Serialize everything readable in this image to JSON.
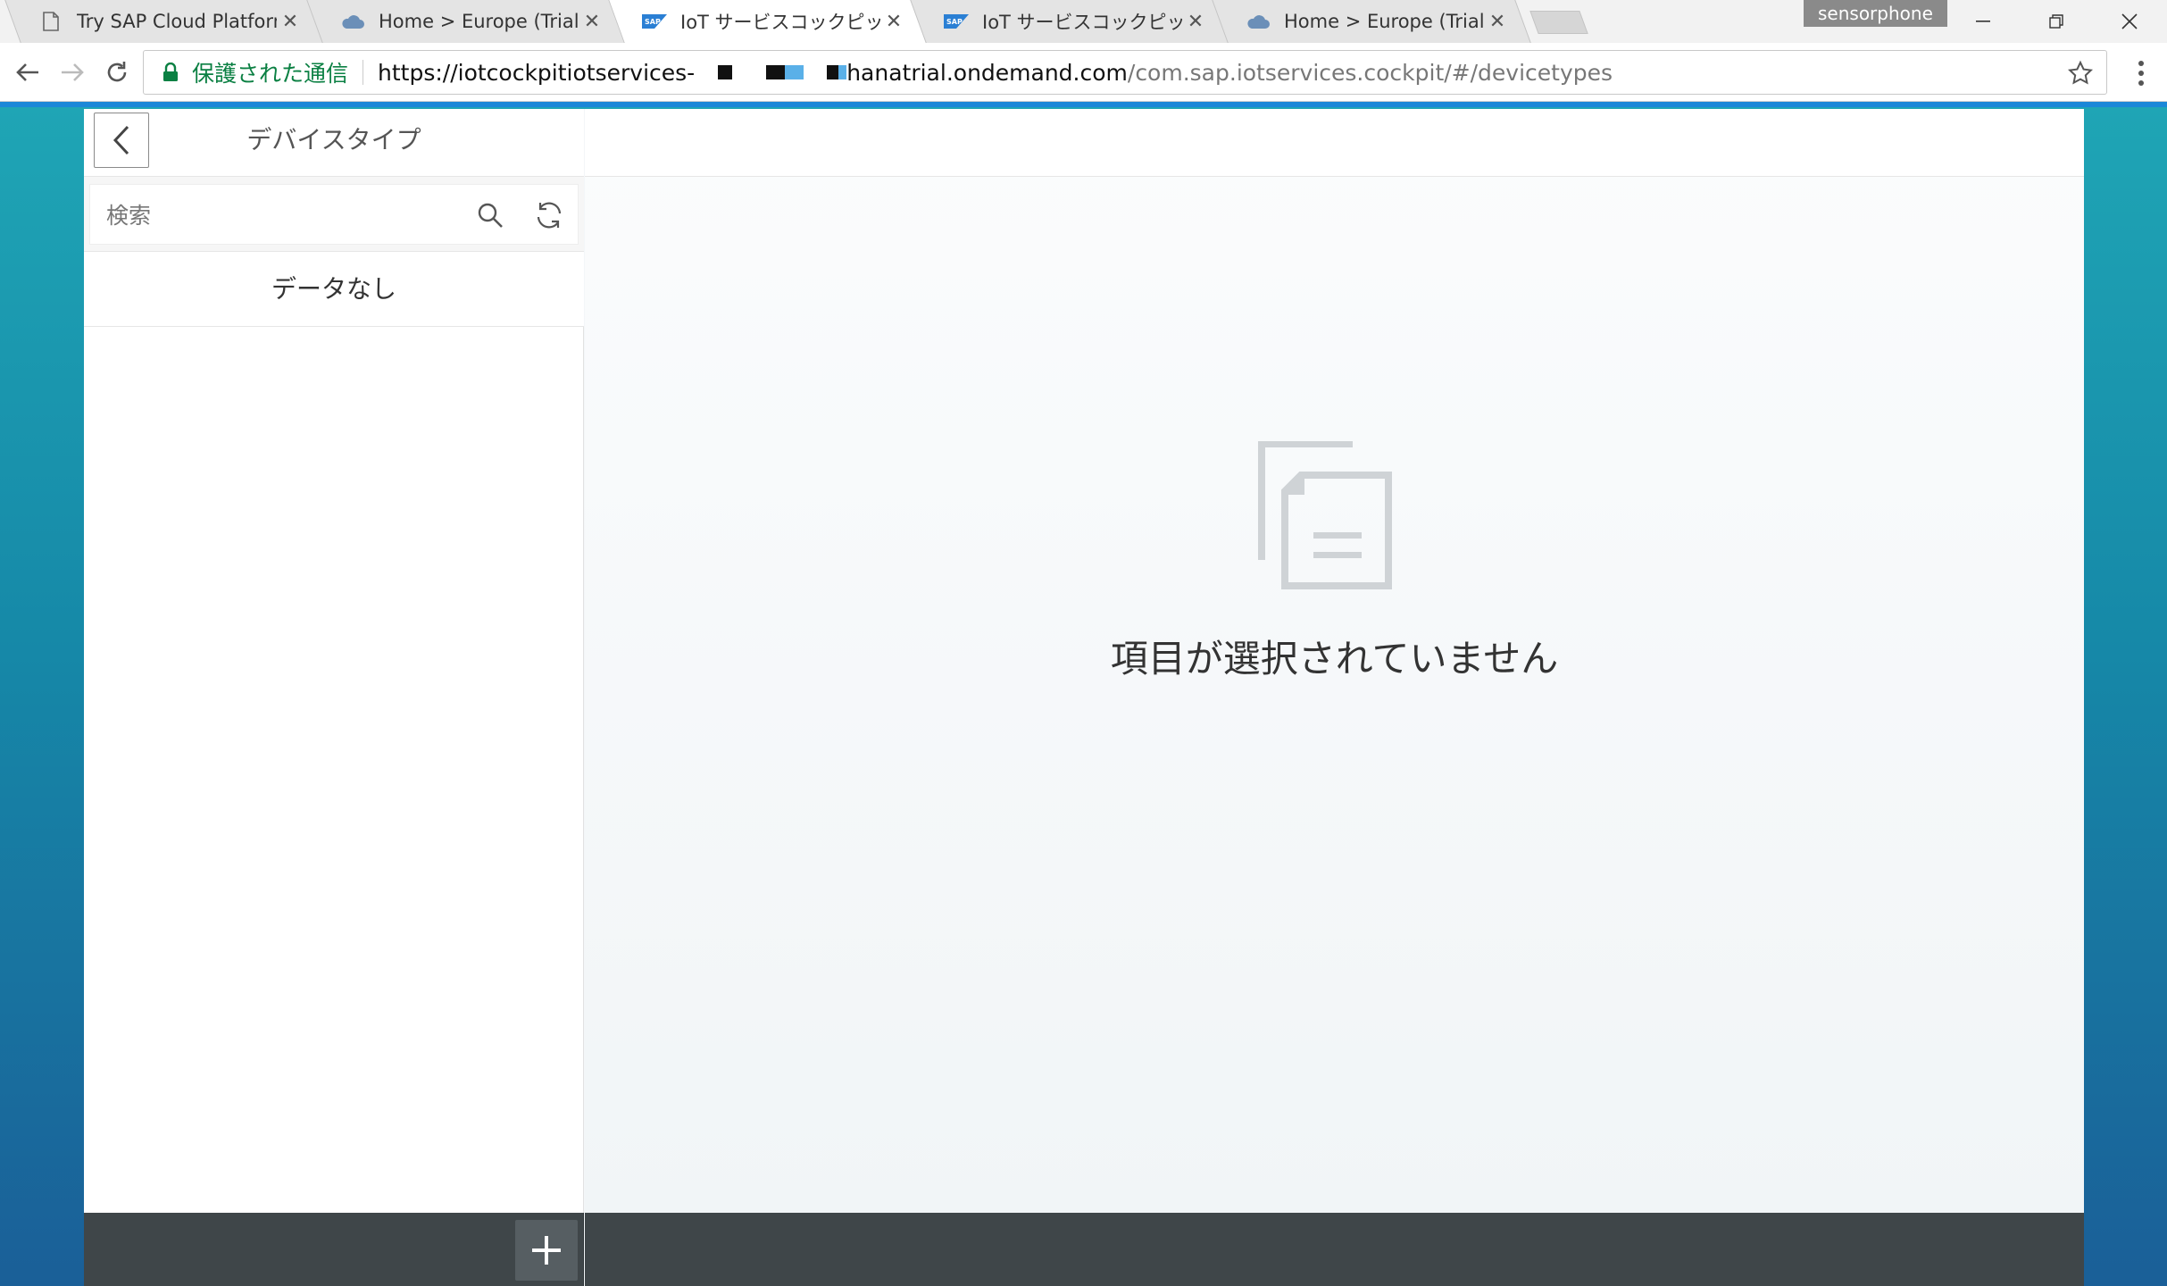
{
  "browser": {
    "tabs": [
      {
        "title": "Try SAP Cloud Platform",
        "icon": "document-icon",
        "active": false
      },
      {
        "title": "Home > Europe (Trial) >",
        "icon": "cloud-icon",
        "active": false
      },
      {
        "title": "IoT サービスコックピット",
        "icon": "sap-logo-icon",
        "active": true
      },
      {
        "title": "IoT サービスコックピット",
        "icon": "sap-logo-icon",
        "active": false
      },
      {
        "title": "Home > Europe (Trial) >",
        "icon": "cloud-icon",
        "active": false
      }
    ],
    "profile_name": "sensorphone",
    "address": {
      "security_label": "保護された通信",
      "url_scheme_host_start": "https://iotcockpitiotservices-",
      "url_host_end": "hanatrial.ondemand.com",
      "url_path": "/com.sap.iotservices.cockpit/#/devicetypes"
    }
  },
  "app": {
    "master": {
      "title": "デバイスタイプ",
      "search_placeholder": "検索",
      "no_data_text": "データなし"
    },
    "detail": {
      "empty_message": "項目が選択されていません"
    }
  },
  "colors": {
    "accent_blue": "#1b87d8",
    "footer_dark": "#3f4649",
    "secure_green": "#0b8043"
  }
}
